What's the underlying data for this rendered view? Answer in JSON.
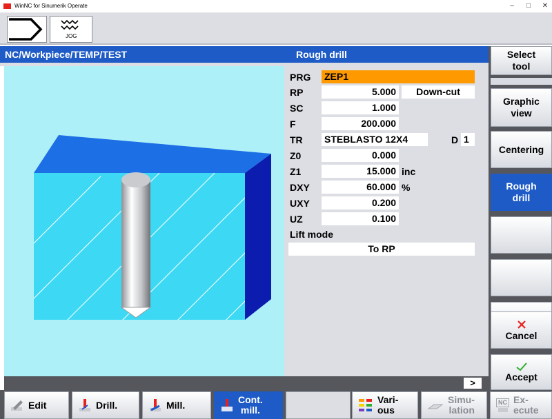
{
  "window": {
    "title": "WinNC for Sinumerik Operate"
  },
  "toolbar": {
    "jog_label": "JOG"
  },
  "header": {
    "path": "NC/Workpiece/TEMP/TEST",
    "cycle_title": "Rough drill"
  },
  "form": {
    "prg_label": "PRG",
    "prg_value": "ZEP1",
    "rp_label": "RP",
    "rp_value": "5.000",
    "rp_mode": "Down-cut",
    "sc_label": "SC",
    "sc_value": "1.000",
    "f_label": "F",
    "f_value": "200.000",
    "tr_label": "TR",
    "tr_value": "STEBLASTO 12X4",
    "d_label": "D",
    "d_value": "1",
    "z0_label": "Z0",
    "z0_value": "0.000",
    "z1_label": "Z1",
    "z1_value": "15.000",
    "z1_unit": "inc",
    "dxy_label": "DXY",
    "dxy_value": "60.000",
    "dxy_unit": "%",
    "uxy_label": "UXY",
    "uxy_value": "0.200",
    "uz_label": "UZ",
    "uz_value": "0.100",
    "lift_label": "Lift mode",
    "lift_value": "To RP"
  },
  "status": {
    "more_label": ">"
  },
  "vsoftkeys": {
    "select_tool_1": "Select",
    "select_tool_2": "tool",
    "graphic_view_1": "Graphic",
    "graphic_view_2": "view",
    "centering": "Centering",
    "rough_drill_1": "Rough",
    "rough_drill_2": "drill",
    "cancel": "Cancel",
    "accept": "Accept"
  },
  "hsoftkeys": {
    "edit": "Edit",
    "drill": "Drill.",
    "mill": "Mill.",
    "cont_mill_1": "Cont.",
    "cont_mill_2": "mill.",
    "various_1": "Vari-",
    "various_2": "ous",
    "simulation_1": "Simu-",
    "simulation_2": "lation",
    "execute_1": "Ex-",
    "execute_2": "ecute",
    "nc_badge": "NC"
  },
  "colors": {
    "header_blue": "#1e5bc6",
    "prg_orange": "#ff9900",
    "cancel_red": "#e8211c",
    "accept_green": "#2fae2f"
  }
}
